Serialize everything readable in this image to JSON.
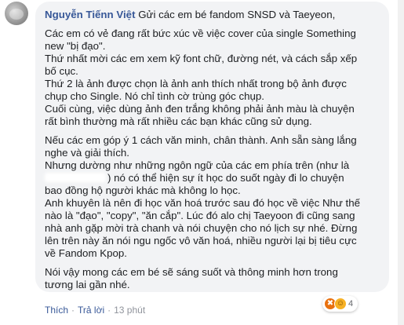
{
  "comment": {
    "author": "Nguyễn Tiếnn Việt",
    "intro": "Gửi các em bé fandom SNSD và Taeyeon,",
    "paragraphs": [
      [
        "Các em có vẻ đang rất bức xúc về việc cover của single Something",
        "new \"bị đạo\".",
        "Thứ nhất mời các em xem kỹ font chữ, đường nét, và cách sắp xếp",
        "bố cục.",
        "Thứ 2 là ảnh được chọn là ảnh anh thích nhất trong bộ ảnh được",
        "chụp cho Single. Nó chỉ tình cờ trùng góc chụp.",
        "Cuối cùng, việc dùng ảnh đen trắng không phải ảnh màu là chuyện",
        "rất bình thường mà rất nhiều các bạn khác cũng sử dụng."
      ],
      [
        "Nếu các em góp ý 1 cách văn minh, chân thành. Anh sẵn sàng lắng",
        "nghe và giải thích.",
        "Nhưng dường như những ngôn ngữ của các em phía trên (như là",
        ") nó có thể hiện sự ít học do suốt ngày đi lo chuyện",
        "bao đồng hộ người khác mà không lo học.",
        "Anh khuyên là nên đi học văn hoá trước sau đó học về việc Như thế",
        "nào là \"đạo\", \"copy\", \"ăn cắp\". Lúc đó alo chị Taeyoon đi cũng sang",
        "nhà anh gặp mời trà chanh và nói chuyện cho nó lịch sự nhé. Đừng",
        "lên trên này ăn nói ngu ngốc vô văn hoá, nhiều người lại bị tiêu cực",
        "về Fandom Kpop."
      ],
      [
        "Nói vậy mong các em bé sẽ sáng suốt và thông minh hơn trong",
        "tương lai gần nhé."
      ]
    ]
  },
  "reactions": {
    "count": "4",
    "icons": [
      "angry-icon",
      "haha-icon"
    ]
  },
  "actions": {
    "like": "Thích",
    "reply": "Trả lời",
    "time": "13 phút"
  }
}
